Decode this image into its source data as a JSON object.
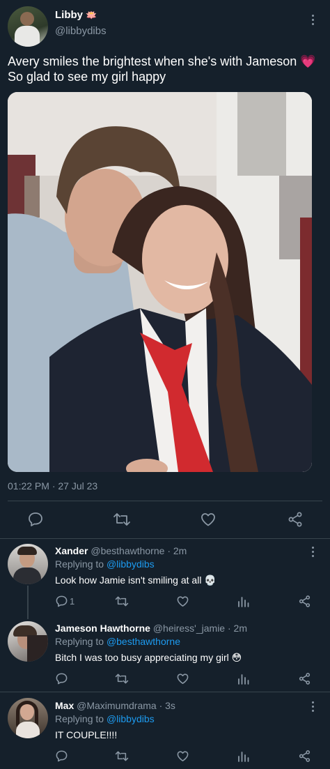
{
  "main_tweet": {
    "author_name": "Libby",
    "author_emoji": "🪷",
    "author_handle": "@libbydibs",
    "text_line1": "Avery smiles the brightest when she's with Jameson",
    "text_emoji": "💗",
    "text_line2": "So glad to see my girl happy",
    "photo_icon": "photo-couple",
    "timestamp": "01:22 PM · 27 Jul 23"
  },
  "replies": [
    {
      "name": "Xander",
      "handle": "@besthawthorne",
      "time": "· 2m",
      "replying_label": "Replying to",
      "replying_to": "@libbydibs",
      "text": "Look how Jamie isn't smiling at all",
      "emoji": "💀",
      "reply_count": "1"
    },
    {
      "name": "Jameson Hawthorne",
      "handle": "@heiress'_jamie",
      "time": "· 2m",
      "replying_label": "Replying to",
      "replying_to": "@besthawthorne",
      "text": "Bitch I was too busy appreciating my girl",
      "emoji": "😳",
      "reply_count": ""
    },
    {
      "name": "Max",
      "handle": "@Maximumdrama",
      "time": "· 3s",
      "replying_label": "Replying to",
      "replying_to": "@libbydibs",
      "text": "IT COUPLE!!!!",
      "emoji": "",
      "reply_count": ""
    }
  ],
  "colors": {
    "background": "#15202b",
    "muted": "#8b98a5",
    "link": "#1d9bf0",
    "divider": "#38444d"
  }
}
